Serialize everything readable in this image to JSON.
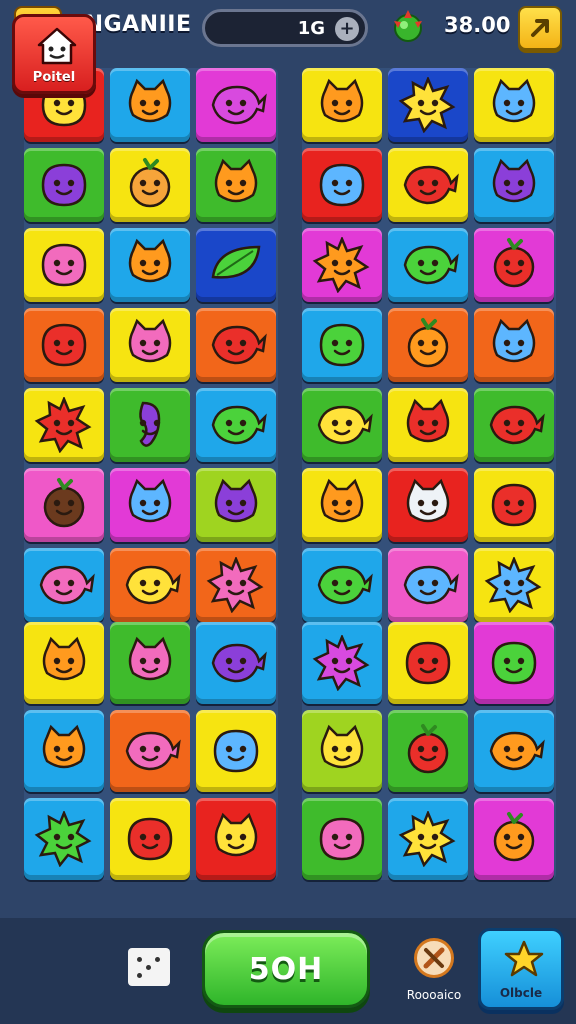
{
  "header": {
    "title": "INGANIIE",
    "counter_value": "1G",
    "counter_add": "+",
    "score": "38.00",
    "back_icon": "chevron-left-icon",
    "share_icon": "arrow-up-right-icon",
    "gem_icon": "green-gem-icon"
  },
  "colors": {
    "red": "#e8231f",
    "blue": "#1fa7ea",
    "magenta": "#e23ad6",
    "yellow": "#f6e411",
    "green": "#3fbb2c",
    "orange": "#f2661a",
    "navy": "#1a47c9",
    "pink": "#ef58c8",
    "lime": "#9fd420"
  },
  "boards": [
    {
      "id": "top-left",
      "tiles": [
        {
          "bg": "red",
          "creature": "yellow-blob"
        },
        {
          "bg": "blue",
          "creature": "orange-cat"
        },
        {
          "bg": "magenta",
          "creature": "magenta-bird"
        },
        {
          "bg": "green",
          "creature": "purple-blob"
        },
        {
          "bg": "yellow",
          "creature": "fruit-basket"
        },
        {
          "bg": "green",
          "creature": "orange-cat"
        },
        {
          "bg": "yellow",
          "creature": "pink-blob"
        },
        {
          "bg": "blue",
          "creature": "orange-cat"
        },
        {
          "bg": "navy",
          "creature": "green-leaf"
        },
        {
          "bg": "orange",
          "creature": "red-blob"
        },
        {
          "bg": "yellow",
          "creature": "pink-cat"
        },
        {
          "bg": "orange",
          "creature": "red-fish"
        },
        {
          "bg": "yellow",
          "creature": "red-star"
        },
        {
          "bg": "green",
          "creature": "purple-seahorse"
        },
        {
          "bg": "blue",
          "creature": "green-bird"
        },
        {
          "bg": "pink",
          "creature": "brown-fruit"
        },
        {
          "bg": "magenta",
          "creature": "blue-cat"
        },
        {
          "bg": "lime",
          "creature": "purple-cat"
        },
        {
          "bg": "blue",
          "creature": "pink-bird"
        },
        {
          "bg": "orange",
          "creature": "yellow-fish"
        },
        {
          "bg": "orange",
          "creature": "pink-star"
        }
      ]
    },
    {
      "id": "top-right",
      "tiles": [
        {
          "bg": "yellow",
          "creature": "orange-cat"
        },
        {
          "bg": "navy",
          "creature": "yellow-sun"
        },
        {
          "bg": "yellow",
          "creature": "blue-cat"
        },
        {
          "bg": "red",
          "creature": "blue-blob"
        },
        {
          "bg": "yellow",
          "creature": "red-fish"
        },
        {
          "bg": "blue",
          "creature": "purple-cat"
        },
        {
          "bg": "magenta",
          "creature": "orange-star"
        },
        {
          "bg": "blue",
          "creature": "green-bird"
        },
        {
          "bg": "magenta",
          "creature": "red-fruit"
        },
        {
          "bg": "blue",
          "creature": "green-blob"
        },
        {
          "bg": "orange",
          "creature": "orange-fruit"
        },
        {
          "bg": "orange",
          "creature": "blue-cat"
        },
        {
          "bg": "green",
          "creature": "yellow-bird"
        },
        {
          "bg": "yellow",
          "creature": "red-cat"
        },
        {
          "bg": "green",
          "creature": "red-fish"
        },
        {
          "bg": "yellow",
          "creature": "orange-cat"
        },
        {
          "bg": "red",
          "creature": "white-cat"
        },
        {
          "bg": "yellow",
          "creature": "red-blob"
        },
        {
          "bg": "blue",
          "creature": "green-fish"
        },
        {
          "bg": "pink",
          "creature": "blue-bird"
        },
        {
          "bg": "yellow",
          "creature": "blue-star"
        }
      ]
    },
    {
      "id": "bottom-left",
      "tiles": [
        {
          "bg": "yellow",
          "creature": "orange-cat"
        },
        {
          "bg": "green",
          "creature": "pink-cat"
        },
        {
          "bg": "blue",
          "creature": "purple-fish"
        },
        {
          "bg": "blue",
          "creature": "orange-fox"
        },
        {
          "bg": "orange",
          "creature": "pink-fish"
        },
        {
          "bg": "yellow",
          "creature": "blue-blob"
        },
        {
          "bg": "blue",
          "creature": "green-star"
        },
        {
          "bg": "yellow",
          "creature": "red-blob"
        },
        {
          "bg": "red",
          "creature": "yellow-cat"
        }
      ]
    },
    {
      "id": "bottom-right",
      "tiles": [
        {
          "bg": "blue",
          "creature": "magenta-star"
        },
        {
          "bg": "yellow",
          "creature": "red-blob"
        },
        {
          "bg": "magenta",
          "creature": "green-blob"
        },
        {
          "bg": "lime",
          "creature": "yellow-cat"
        },
        {
          "bg": "green",
          "creature": "red-fruit"
        },
        {
          "bg": "blue",
          "creature": "orange-fish"
        },
        {
          "bg": "green",
          "creature": "pink-blob"
        },
        {
          "bg": "blue",
          "creature": "yellow-star"
        },
        {
          "bg": "magenta",
          "creature": "orange-fruit"
        }
      ]
    }
  ],
  "footer": {
    "home_label": "Poitel",
    "home_icon": "house-icon",
    "dice_icon": "dice-icon",
    "play_label": "5OH",
    "resource_label": "Roooaico",
    "resource_icon": "tools-icon",
    "goals_label": "Olbcle",
    "goals_icon": "star-icon"
  }
}
